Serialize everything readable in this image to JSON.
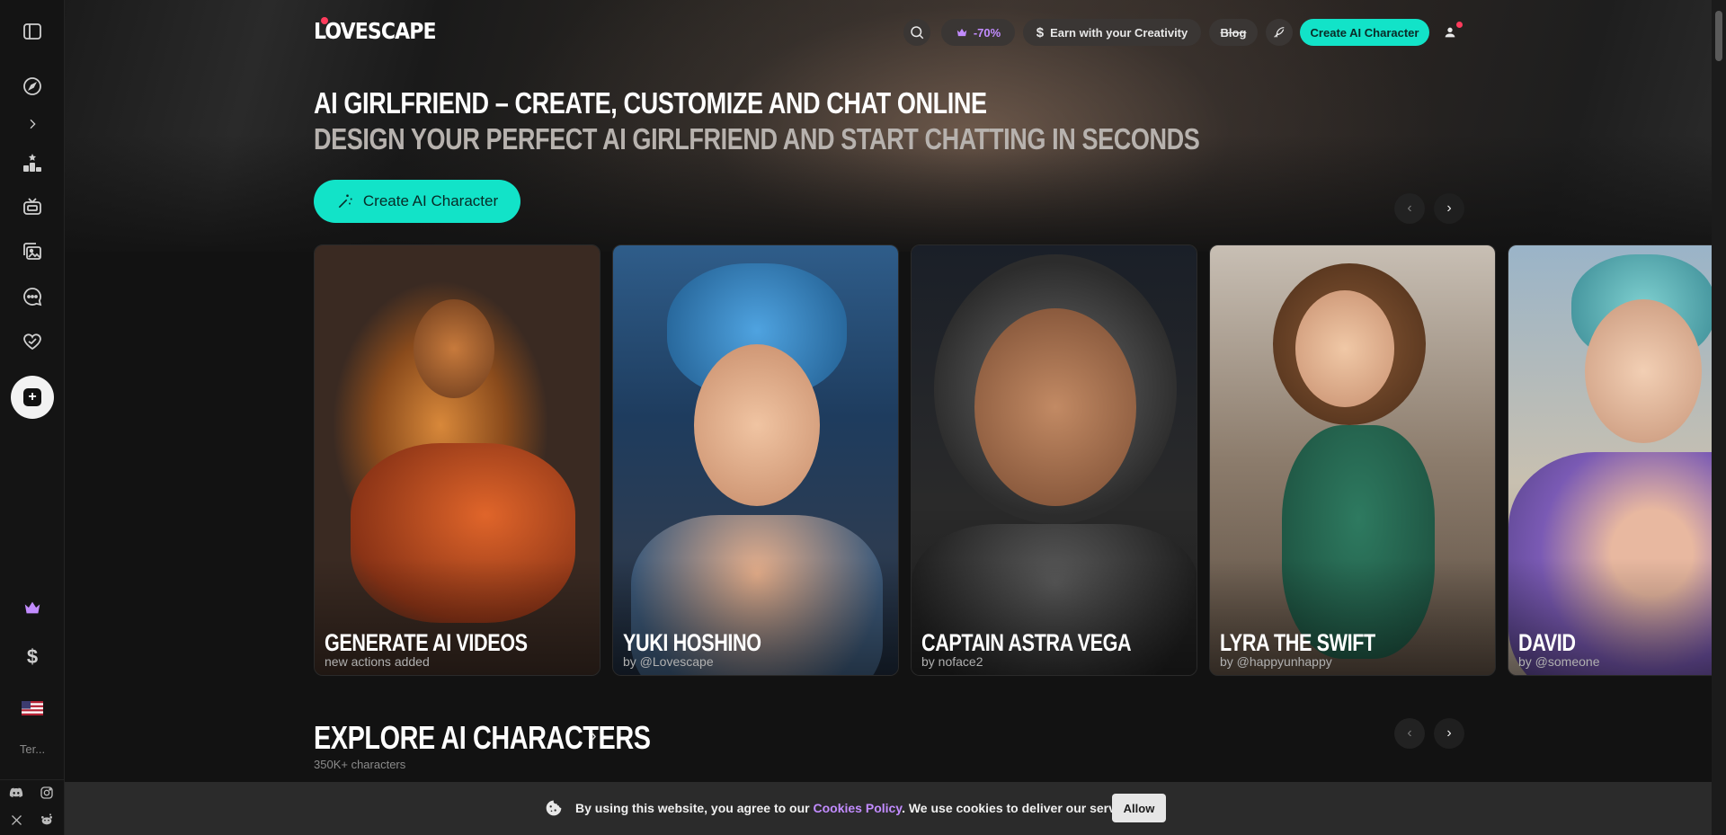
{
  "brand": {
    "logo_text": "LOVESCAPE"
  },
  "header": {
    "search_icon": "search-icon",
    "promo_label": "-70%",
    "earn_label": "Earn with your Creativity",
    "blog_label": "Blog",
    "create_label": "Create AI Character"
  },
  "sidebar": {
    "items": [
      {
        "icon": "sidebar-toggle-icon"
      },
      {
        "icon": "compass-icon"
      },
      {
        "icon": "chevron-right-icon"
      },
      {
        "icon": "leaderboard-icon"
      },
      {
        "icon": "tv-icon"
      },
      {
        "icon": "gallery-icon"
      },
      {
        "icon": "chat-icon"
      },
      {
        "icon": "heart-icon"
      }
    ],
    "terms_label": "Ter...",
    "colors": {
      "crown": "#c28cff"
    }
  },
  "hero": {
    "title": "AI GIRLFRIEND – CREATE, CUSTOMIZE AND CHAT ONLINE",
    "subtitle": "DESIGN YOUR PERFECT AI GIRLFRIEND AND START CHATTING IN SECONDS",
    "cta_label": "Create AI Character"
  },
  "cards": [
    {
      "title": "GENERATE AI VIDEOS",
      "subtitle": "new actions added"
    },
    {
      "title": "YUKI HOSHINO",
      "subtitle": "by @Lovescape"
    },
    {
      "title": "CAPTAIN ASTRA VEGA",
      "subtitle": "by noface2"
    },
    {
      "title": "LYRA THE SWIFT",
      "subtitle": "by @happyunhappy"
    },
    {
      "title": "DAVID",
      "subtitle": "by @someone"
    }
  ],
  "explore": {
    "title": "EXPLORE AI CHARACTERS",
    "subtitle": "350K+ characters"
  },
  "cookie": {
    "text_before": "By using this website, you agree to our ",
    "link": "Cookies Policy",
    "text_after": ". We use cookies to deliver our services.",
    "allow_label": "Allow"
  },
  "colors": {
    "accent": "#12e3c8",
    "promo": "#c28cff",
    "background": "#121212"
  }
}
